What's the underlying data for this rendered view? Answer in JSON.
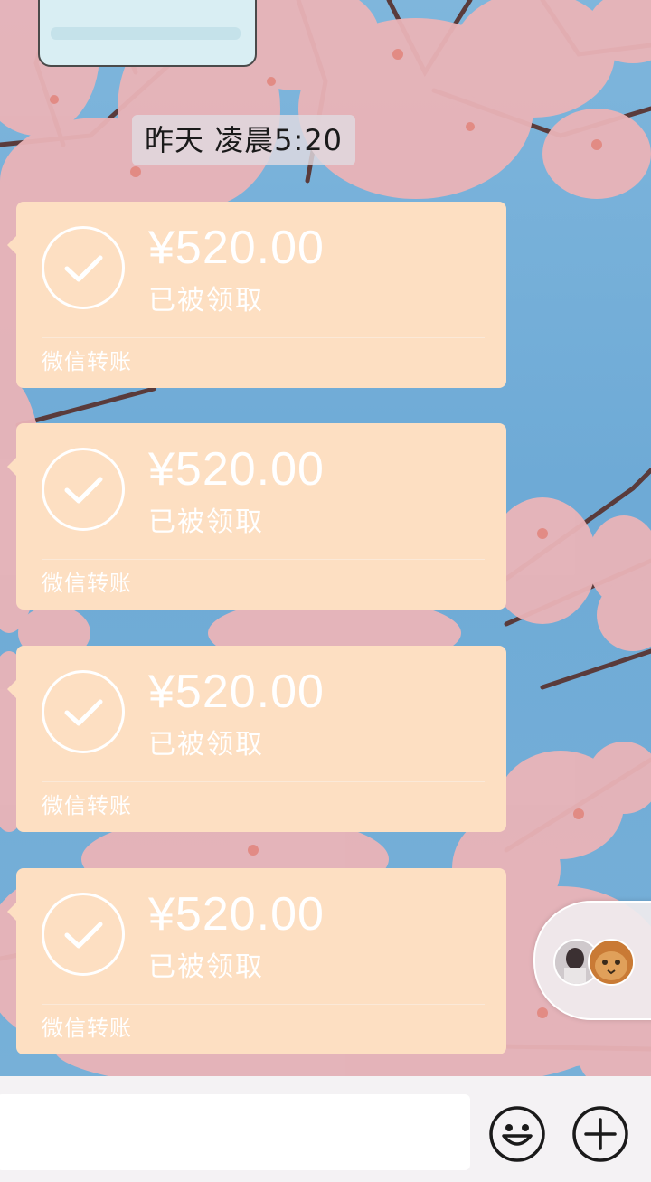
{
  "timestamp": "昨天 凌晨5:20",
  "transfers": [
    {
      "amount": "¥520.00",
      "status": "已被领取",
      "label": "微信转账"
    },
    {
      "amount": "¥520.00",
      "status": "已被领取",
      "label": "微信转账"
    },
    {
      "amount": "¥520.00",
      "status": "已被领取",
      "label": "微信转账"
    },
    {
      "amount": "¥520.00",
      "status": "已被领取",
      "label": "微信转账"
    }
  ],
  "input": {
    "placeholder": ""
  },
  "icons": {
    "emoji": "smiley-icon",
    "more": "plus-circle-icon",
    "check": "check-circle-icon"
  },
  "colors": {
    "card": "#fddfc2",
    "sky": "#76b0d8",
    "blossom": "#e9b3b8"
  }
}
